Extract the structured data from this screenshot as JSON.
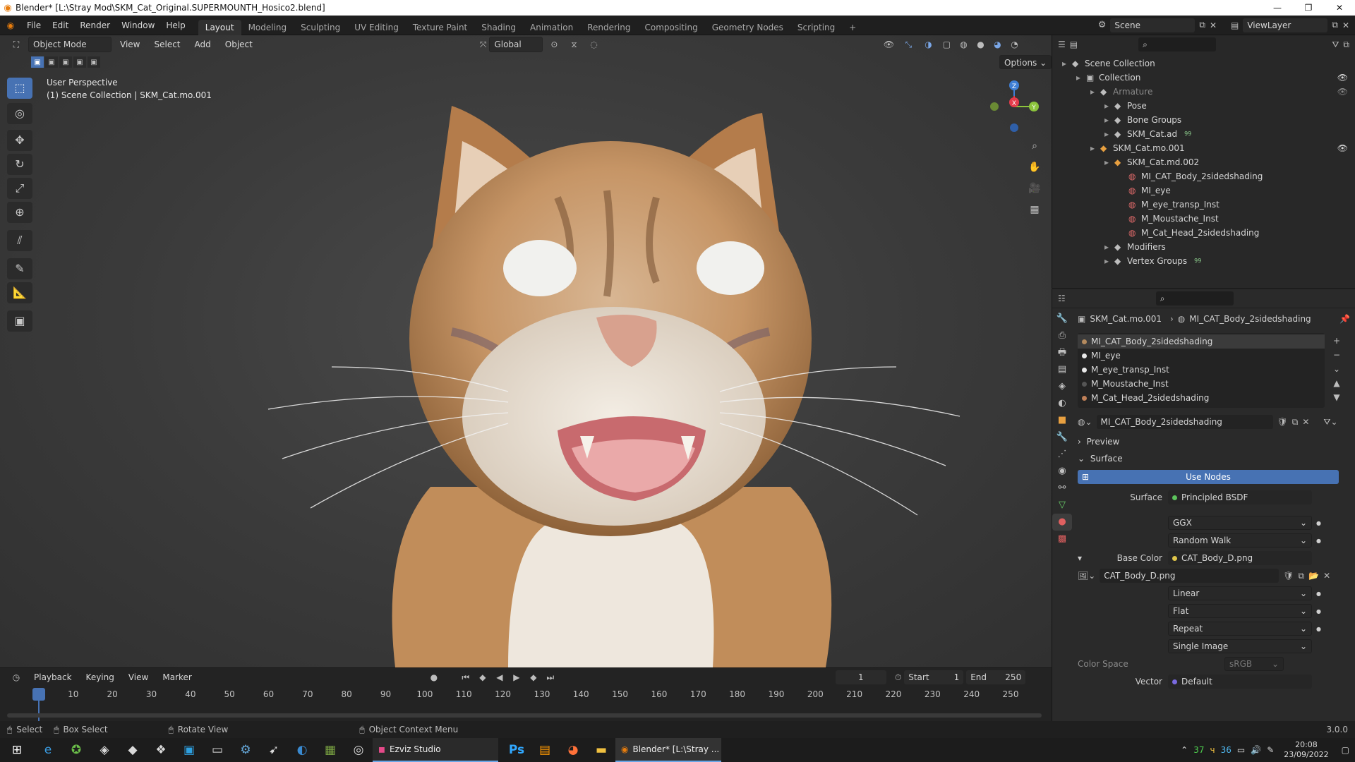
{
  "window": {
    "title": "Blender* [L:\\Stray Mod\\SKM_Cat_Original.SUPERMOUNTH_Hosico2.blend]",
    "min": "—",
    "max": "❐",
    "close": "✕"
  },
  "menu": [
    "File",
    "Edit",
    "Render",
    "Window",
    "Help"
  ],
  "workspaces": [
    "Layout",
    "Modeling",
    "Sculpting",
    "UV Editing",
    "Texture Paint",
    "Shading",
    "Animation",
    "Rendering",
    "Compositing",
    "Geometry Nodes",
    "Scripting"
  ],
  "workspace_add": "+",
  "scene": {
    "label": "Scene",
    "viewlayer": "ViewLayer"
  },
  "viewport": {
    "mode": "Object Mode",
    "menus": [
      "View",
      "Select",
      "Add",
      "Object"
    ],
    "transform": "Global",
    "options": "Options",
    "overlay_line1": "User Perspective",
    "overlay_line2": "(1) Scene Collection | SKM_Cat.mo.001",
    "gizmo": {
      "z": "Z",
      "x": "X",
      "y": "Y"
    }
  },
  "outliner": {
    "items": [
      {
        "label": "Scene Collection",
        "depth": 0,
        "icon": "scene-collection-icon"
      },
      {
        "label": "Collection",
        "depth": 1,
        "icon": "collection-icon"
      },
      {
        "label": "Armature",
        "depth": 2,
        "icon": "armature-icon",
        "dim": true
      },
      {
        "label": "Pose",
        "depth": 3,
        "icon": "pose-icon"
      },
      {
        "label": "Bone Groups",
        "depth": 3,
        "icon": "bone-groups-icon"
      },
      {
        "label": "SKM_Cat.ad",
        "depth": 3,
        "icon": "armature-data-icon",
        "badge": "99"
      },
      {
        "label": "SKM_Cat.mo.001",
        "depth": 2,
        "icon": "mesh-object-icon"
      },
      {
        "label": "SKM_Cat.md.002",
        "depth": 3,
        "icon": "mesh-data-icon"
      },
      {
        "label": "MI_CAT_Body_2sidedshading",
        "depth": 4,
        "icon": "material-icon"
      },
      {
        "label": "MI_eye",
        "depth": 4,
        "icon": "material-icon"
      },
      {
        "label": "M_eye_transp_Inst",
        "depth": 4,
        "icon": "material-icon"
      },
      {
        "label": "M_Moustache_Inst",
        "depth": 4,
        "icon": "material-icon"
      },
      {
        "label": "M_Cat_Head_2sidedshading",
        "depth": 4,
        "icon": "material-icon"
      },
      {
        "label": "Modifiers",
        "depth": 3,
        "icon": "wrench-icon"
      },
      {
        "label": "Vertex Groups",
        "depth": 3,
        "icon": "vertex-groups-icon",
        "badge": "99"
      }
    ]
  },
  "properties": {
    "breadcrumb_object": "SKM_Cat.mo.001",
    "breadcrumb_material": "MI_CAT_Body_2sidedshading",
    "material_slots": [
      "MI_CAT_Body_2sidedshading",
      "MI_eye",
      "M_eye_transp_Inst",
      "M_Moustache_Inst",
      "M_Cat_Head_2sidedshading"
    ],
    "material_name": "MI_CAT_Body_2sidedshading",
    "preview": "Preview",
    "surface_section": "Surface",
    "use_nodes": "Use Nodes",
    "surface_label": "Surface",
    "surface_value": "Principled BSDF",
    "distribution": "GGX",
    "subsurface": "Random Walk",
    "base_color_label": "Base Color",
    "base_color_value": "CAT_Body_D.png",
    "image_name": "CAT_Body_D.png",
    "interpolation": "Linear",
    "projection": "Flat",
    "extension": "Repeat",
    "source": "Single Image",
    "color_space_label": "Color Space",
    "color_space_value": "sRGB",
    "vector_label": "Vector",
    "vector_value": "Default"
  },
  "timeline": {
    "menus": [
      "Playback",
      "Keying",
      "View",
      "Marker"
    ],
    "current_frame": "1",
    "start_label": "Start",
    "start": "1",
    "end_label": "End",
    "end": "250",
    "ticks": [
      "1",
      "10",
      "20",
      "30",
      "40",
      "50",
      "60",
      "70",
      "80",
      "90",
      "100",
      "110",
      "120",
      "130",
      "140",
      "150",
      "160",
      "170",
      "180",
      "190",
      "200",
      "210",
      "220",
      "230",
      "240",
      "250"
    ]
  },
  "statusbar": {
    "select": "Select",
    "box_select": "Box Select",
    "rotate": "Rotate View",
    "context_menu": "Object Context Menu",
    "version": "3.0.0"
  },
  "taskbar": {
    "ezviz": "Ezviz Studio",
    "blender": "Blender* [L:\\Stray ...",
    "tray_a": "37",
    "tray_b": "36",
    "time": "20:08",
    "date": "23/09/2022"
  },
  "colors": {
    "accent": "#4772b3",
    "x_axis": "#e63b4b",
    "y_axis": "#8cc43c",
    "z_axis": "#3f7fd6"
  }
}
